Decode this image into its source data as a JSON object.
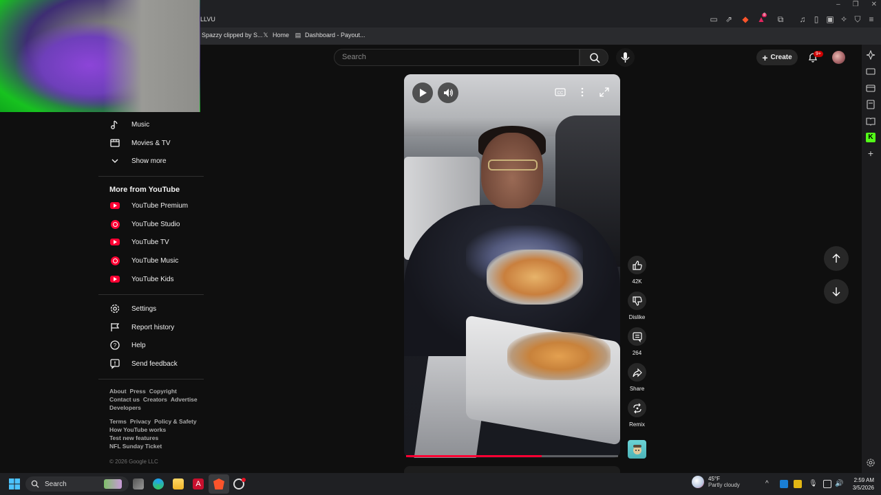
{
  "browser": {
    "tab_title": "LLVU",
    "bookmarks": [
      {
        "label": "Spazzy clipped by S..."
      },
      {
        "label": "Home"
      },
      {
        "label": "Dashboard - Payout..."
      }
    ],
    "extension_badge": "8"
  },
  "header": {
    "search_placeholder": "Search",
    "create_label": "Create",
    "notifications_badge": "9+"
  },
  "sidebar": {
    "top_items": [
      {
        "label": "Music",
        "icon": "music-note-icon"
      },
      {
        "label": "Movies & TV",
        "icon": "film-icon"
      },
      {
        "label": "Show more",
        "icon": "chevron-down-icon"
      }
    ],
    "more_heading": "More from YouTube",
    "more_items": [
      {
        "label": "YouTube Premium",
        "icon": "youtube-premium-icon"
      },
      {
        "label": "YouTube Studio",
        "icon": "youtube-studio-icon"
      },
      {
        "label": "YouTube TV",
        "icon": "youtube-tv-icon"
      },
      {
        "label": "YouTube Music",
        "icon": "youtube-music-icon"
      },
      {
        "label": "YouTube Kids",
        "icon": "youtube-kids-icon"
      }
    ],
    "settings_items": [
      {
        "label": "Settings",
        "icon": "gear-icon"
      },
      {
        "label": "Report history",
        "icon": "flag-icon"
      },
      {
        "label": "Help",
        "icon": "help-icon"
      },
      {
        "label": "Send feedback",
        "icon": "feedback-icon"
      }
    ],
    "footer_row1": [
      "About",
      "Press",
      "Copyright"
    ],
    "footer_row2": [
      "Contact us",
      "Creators",
      "Advertise"
    ],
    "footer_row3": [
      "Developers"
    ],
    "footer_row4": [
      "Terms",
      "Privacy",
      "Policy & Safety"
    ],
    "footer_row5": [
      "How YouTube works"
    ],
    "footer_row6": [
      "Test new features"
    ],
    "footer_row7": [
      "NFL Sunday Ticket"
    ],
    "copyright": "© 2026 Google LLC"
  },
  "player": {
    "progress_fraction": 0.64
  },
  "actions": {
    "like_count": "42K",
    "dislike_label": "Dislike",
    "comment_count": "264",
    "share_label": "Share",
    "remix_label": "Remix"
  },
  "taskbar": {
    "search_label": "Search",
    "weather_temp": "45°F",
    "weather_desc": "Partly cloudy",
    "time": "2:59 AM",
    "date": "3/5/2026"
  }
}
